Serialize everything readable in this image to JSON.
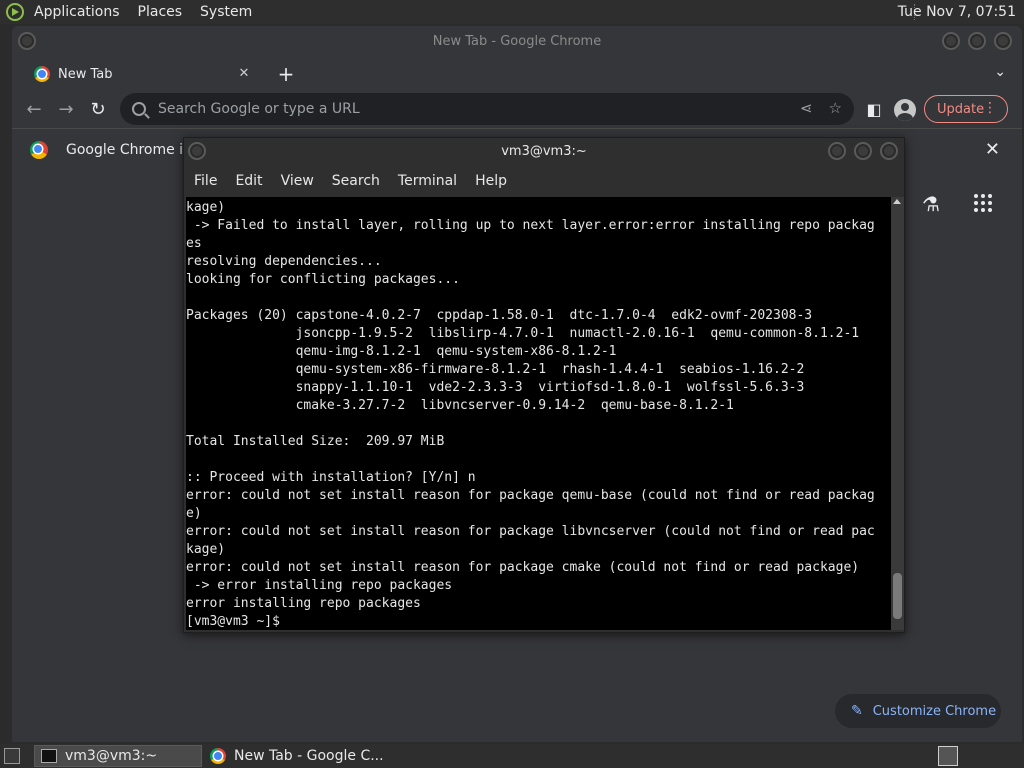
{
  "top_panel": {
    "menus": [
      "Applications",
      "Places",
      "System"
    ],
    "clock": "Tue Nov  7, 07:51"
  },
  "chrome": {
    "window_title": "New Tab - Google Chrome",
    "tab_title": "New Tab",
    "omnibox_placeholder": "Search Google or type a URL",
    "update_label": "Update",
    "infobar_text": "Google Chrome isn",
    "customize_label": "Customize Chrome"
  },
  "terminal": {
    "title": "vm3@vm3:~",
    "menus": [
      "File",
      "Edit",
      "View",
      "Search",
      "Terminal",
      "Help"
    ],
    "lines": [
      "kage)",
      " -> Failed to install layer, rolling up to next layer.error:error installing repo packag",
      "es",
      "resolving dependencies...",
      "looking for conflicting packages...",
      "",
      "Packages (20) capstone-4.0.2-7  cppdap-1.58.0-1  dtc-1.7.0-4  edk2-ovmf-202308-3",
      "              jsoncpp-1.9.5-2  libslirp-4.7.0-1  numactl-2.0.16-1  qemu-common-8.1.2-1",
      "              qemu-img-8.1.2-1  qemu-system-x86-8.1.2-1",
      "              qemu-system-x86-firmware-8.1.2-1  rhash-1.4.4-1  seabios-1.16.2-2",
      "              snappy-1.1.10-1  vde2-2.3.3-3  virtiofsd-1.8.0-1  wolfssl-5.6.3-3",
      "              cmake-3.27.7-2  libvncserver-0.9.14-2  qemu-base-8.1.2-1",
      "",
      "Total Installed Size:  209.97 MiB",
      "",
      ":: Proceed with installation? [Y/n] n",
      "error: could not set install reason for package qemu-base (could not find or read packag",
      "e)",
      "error: could not set install reason for package libvncserver (could not find or read pac",
      "kage)",
      "error: could not set install reason for package cmake (could not find or read package)",
      " -> error installing repo packages",
      "error installing repo packages",
      "[vm3@vm3 ~]$ "
    ]
  },
  "taskbar": {
    "tasks": [
      "vm3@vm3:~",
      "New Tab - Google C..."
    ]
  }
}
